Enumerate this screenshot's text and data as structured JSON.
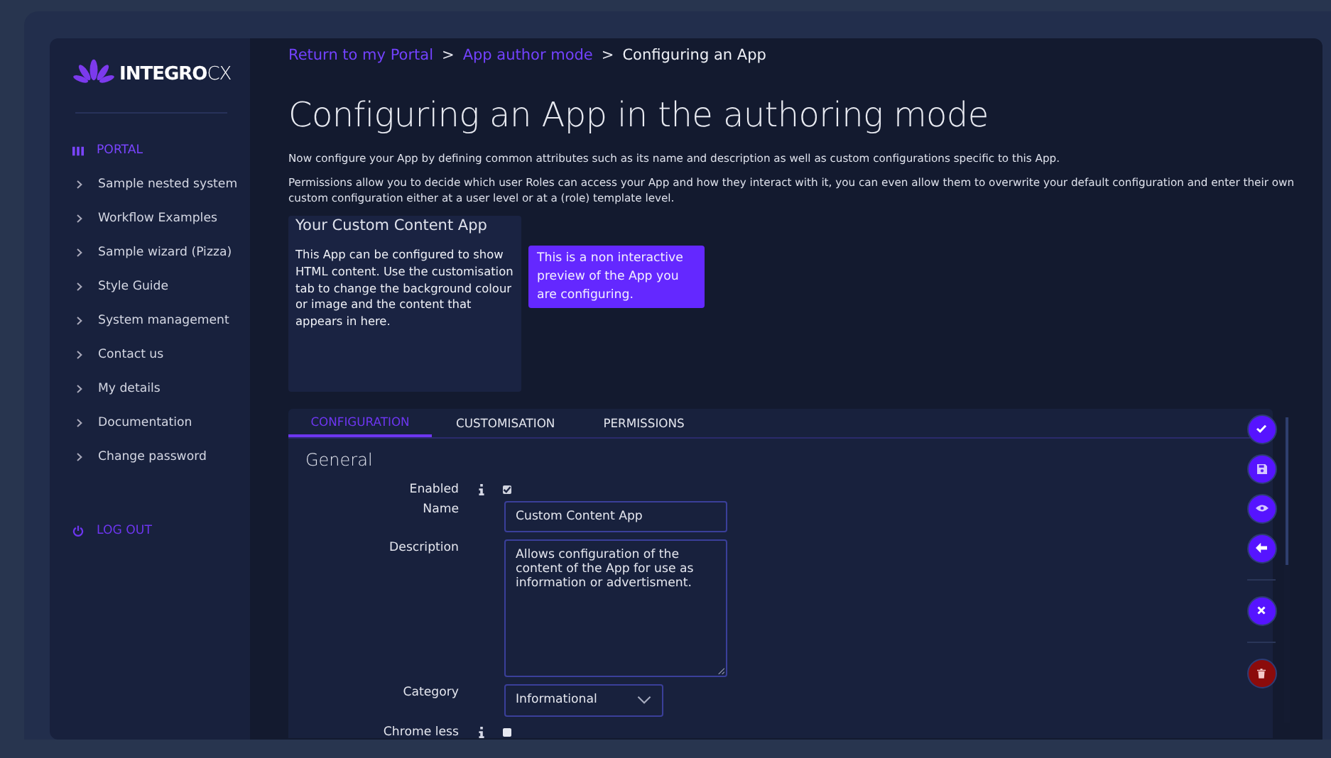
{
  "logo": {
    "brand_bold": "INTEGRO",
    "brand_light": "CX"
  },
  "sidebar": {
    "items": [
      {
        "kind": "header",
        "label": "PORTAL",
        "selected": true
      },
      {
        "kind": "link",
        "label": "Sample nested system",
        "selected": false
      },
      {
        "kind": "link",
        "label": "Workflow Examples",
        "selected": false
      },
      {
        "kind": "link",
        "label": "Sample wizard (Pizza)",
        "selected": false
      },
      {
        "kind": "link",
        "label": "Style Guide",
        "selected": false
      },
      {
        "kind": "link",
        "label": "System management",
        "selected": false
      },
      {
        "kind": "link",
        "label": "Contact us",
        "selected": false
      },
      {
        "kind": "link",
        "label": "My details",
        "selected": false
      },
      {
        "kind": "link",
        "label": "Documentation",
        "selected": false
      },
      {
        "kind": "link",
        "label": "Change password",
        "selected": false
      }
    ],
    "logout": "LOG OUT"
  },
  "breadcrumb": [
    {
      "label": "Return to my Portal",
      "link": true
    },
    {
      "label": "App author mode",
      "link": true
    },
    {
      "label": "Configuring an App",
      "link": false
    }
  ],
  "breadcrumb_separator": ">",
  "title": "Configuring an App in the authoring mode",
  "paragraphs": [
    "Now configure your App by defining common attributes such as its name and description as well as custom configurations specific to this App.",
    "Permissions allow you to decide which user Roles can access your App and how they interact with it, you can even allow them to overwrite your default configuration and enter their own custom configuration either at a user level or at a (role) template level."
  ],
  "preview": {
    "title": "Your Custom Content App",
    "body": "This App can be configured to show HTML content. Use the customisation tab to change the background colour or image and the content that appears in here.",
    "tooltip": "This is a non interactive preview of the App you are configuring."
  },
  "tabs": [
    {
      "label": "CONFIGURATION",
      "selected": true
    },
    {
      "label": "CUSTOMISATION",
      "selected": false
    },
    {
      "label": "PERMISSIONS",
      "selected": false
    }
  ],
  "section_title": "General",
  "fields": [
    {
      "kind": "checkbox",
      "label": "Enabled",
      "info": true,
      "checked": true
    },
    {
      "kind": "text",
      "label": "Name",
      "info": false,
      "value": "Custom Content App"
    },
    {
      "kind": "textarea",
      "label": "Description",
      "info": false,
      "value": "Allows configuration of the content of the App for use as information or advertisment."
    },
    {
      "kind": "select",
      "label": "Category",
      "info": false,
      "value": "Informational"
    },
    {
      "kind": "checkbox",
      "label": "Chrome less",
      "info": true,
      "checked": false
    }
  ],
  "actions": [
    {
      "kind": "check"
    },
    {
      "kind": "save"
    },
    {
      "kind": "eye"
    },
    {
      "kind": "back"
    },
    {
      "kind": "divider"
    },
    {
      "kind": "close"
    },
    {
      "kind": "divider"
    },
    {
      "kind": "delete"
    }
  ]
}
